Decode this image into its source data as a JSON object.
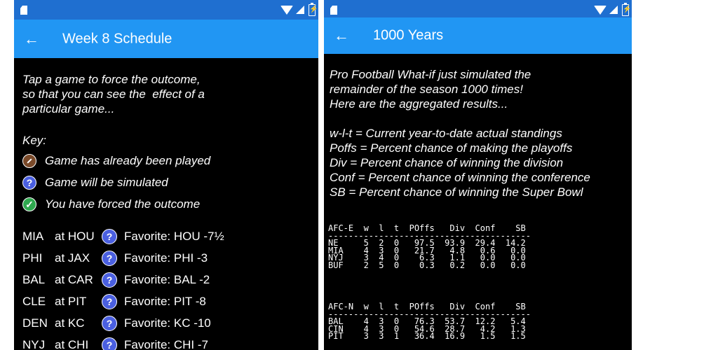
{
  "left": {
    "title": "Week 8 Schedule",
    "intro": [
      "Tap a game to force the outcome,",
      "so that you can see the  effect of a",
      "particular game..."
    ],
    "key_title": "Key:",
    "key": [
      {
        "icon": "football-icon",
        "label": "Game has already been played"
      },
      {
        "icon": "question-icon",
        "label": "Game will be simulated"
      },
      {
        "icon": "check-icon",
        "label": "You have forced the outcome"
      }
    ],
    "games": [
      {
        "away": "MIA",
        "home": "at HOU",
        "q": "?",
        "favorite": "Favorite: HOU -7½"
      },
      {
        "away": "PHI",
        "home": "at JAX",
        "q": "?",
        "favorite": "Favorite: PHI -3"
      },
      {
        "away": "BAL",
        "home": "at CAR",
        "q": "?",
        "favorite": "Favorite: BAL -2"
      },
      {
        "away": "CLE",
        "home": "at PIT",
        "q": "?",
        "favorite": "Favorite: PIT -8"
      },
      {
        "away": "DEN",
        "home": "at KC",
        "q": "?",
        "favorite": "Favorite: KC -10"
      },
      {
        "away": "NYJ",
        "home": "at CHI",
        "q": "?",
        "favorite": "Favorite: CHI -7"
      }
    ]
  },
  "right": {
    "title": "1000 Years",
    "intro": [
      "Pro Football What-if just simulated the",
      "remainder of the season 1000 times!",
      "Here are the aggregated results..."
    ],
    "legend": [
      "w-l-t = Current year-to-date actual standings",
      "Poffs = Percent chance of making the playoffs",
      "Div = Percent chance of winning the division",
      "Conf = Percent chance of winning the conference",
      "SB = Percent chance of winning the Super Bowl"
    ],
    "tables": [
      {
        "header": "AFC-E  w  l  t  POffs   Div  Conf    SB",
        "divider": "----------------------------------------",
        "rows": [
          "NE     5  2  0   97.5  93.9  29.4  14.2",
          "MIA    4  3  0   21.7   4.8   0.6   0.0",
          "NYJ    3  4  0    6.3   1.1   0.0   0.0",
          "BUF    2  5  0    0.3   0.2   0.0   0.0"
        ]
      },
      {
        "header": "AFC-N  w  l  t  POffs   Div  Conf    SB",
        "divider": "----------------------------------------",
        "rows": [
          "BAL    4  3  0   76.3  53.7  12.2   5.4",
          "CIN    4  3  0   54.6  28.7   4.2   1.3",
          "PIT    3  3  1   36.4  16.9   1.5   1.5"
        ]
      }
    ]
  },
  "colors": {
    "statusbar": "#1f6fd0",
    "appbar": "#2196f3",
    "background": "#000000"
  }
}
